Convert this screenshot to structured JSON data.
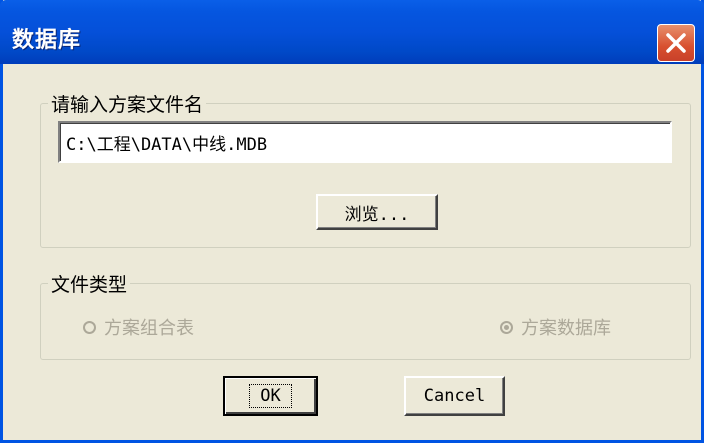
{
  "window": {
    "title": "数据库",
    "close_icon": "close-icon"
  },
  "file_group": {
    "label": "请输入方案文件名",
    "path_value": "C:\\工程\\DATA\\中线.MDB",
    "browse_label": "浏览..."
  },
  "type_group": {
    "label": "文件类型",
    "options": [
      {
        "label": "方案组合表",
        "checked": false,
        "enabled": false
      },
      {
        "label": "方案数据库",
        "checked": true,
        "enabled": false
      }
    ]
  },
  "buttons": {
    "ok_label": "OK",
    "cancel_label": "Cancel"
  },
  "colors": {
    "titlebar": "#0054e3",
    "dialog_bg": "#ece9d8",
    "close": "#d8502f",
    "disabled_text": "#aca899"
  }
}
